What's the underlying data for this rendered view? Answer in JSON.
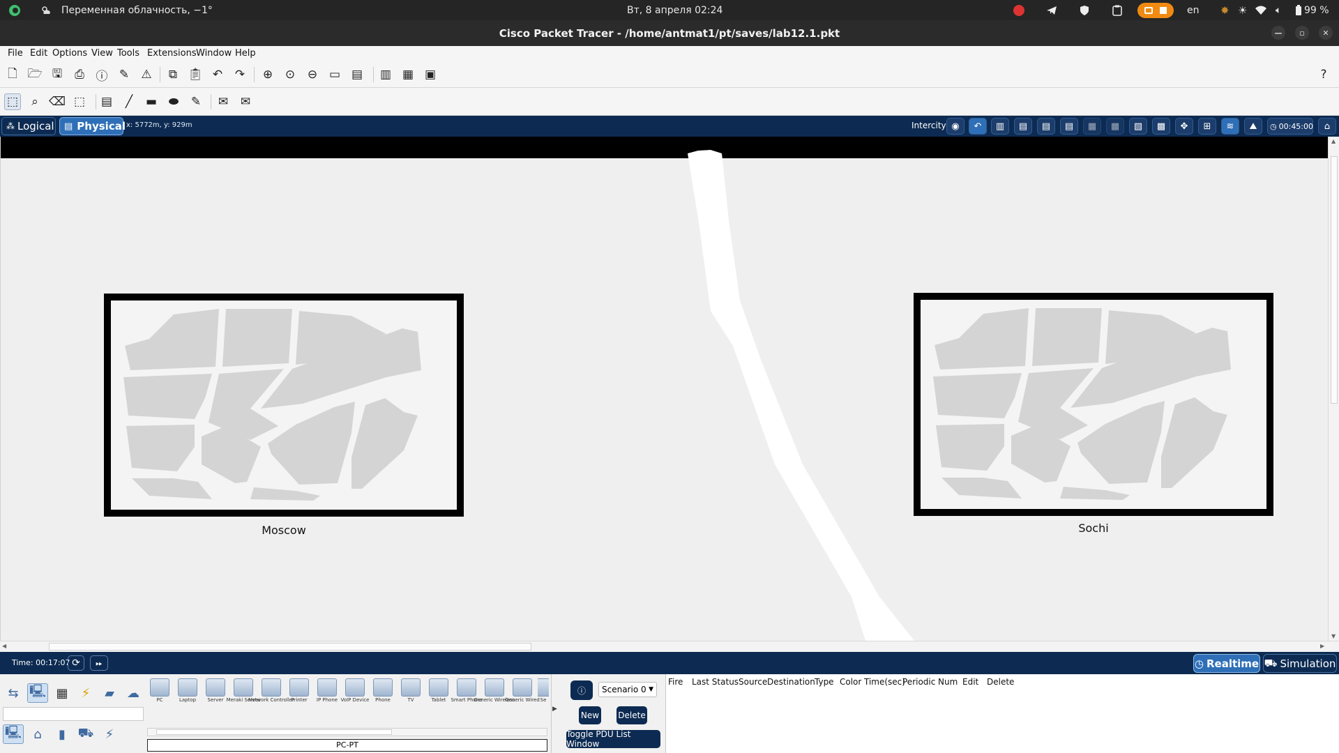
{
  "system_bar": {
    "weather": "Переменная облачность, −1°",
    "datetime": "Вт, 8 апреля  02:24",
    "language": "en",
    "battery": "99 %"
  },
  "window": {
    "title": "Cisco Packet Tracer - /home/antmat1/pt/saves/lab12.1.pkt"
  },
  "menu": [
    "File",
    "Edit",
    "Options",
    "View",
    "Tools",
    "Extensions",
    "Window",
    "Help"
  ],
  "workspace": {
    "logical_tab": "Logical",
    "physical_tab": "Physical",
    "cursor_coords": "x: 5772m, y: 929m",
    "location_label": "Intercity",
    "clock": "00:45:00"
  },
  "canvas": {
    "cities": [
      {
        "name": "Moscow"
      },
      {
        "name": "Sochi"
      }
    ]
  },
  "time_bar": {
    "time": "Time: 00:17:07",
    "realtime_label": "Realtime",
    "simulation_label": "Simulation"
  },
  "devices": {
    "items": [
      "PC",
      "Laptop",
      "Server",
      "Meraki Server",
      "Network Controller",
      "Printer",
      "IP Phone",
      "VoIP Device",
      "Phone",
      "TV",
      "Tablet",
      "Smart Phone",
      "Generic Wireless",
      "Generic Wired",
      "Se"
    ],
    "selected": "PC-PT"
  },
  "scenario": {
    "name": "Scenario 0",
    "new_label": "New",
    "delete_label": "Delete",
    "toggle_label": "Toggle PDU List Window"
  },
  "pdu_columns": [
    "Fire",
    "Last Status",
    "Source",
    "Destination",
    "Type",
    "Color",
    "Time(sec)",
    "Periodic",
    "Num",
    "Edit",
    "Delete"
  ],
  "colors": {
    "accent_navy": "#0d2b52",
    "tab_blue": "#2e6fb7",
    "system_bar": "#252525"
  }
}
